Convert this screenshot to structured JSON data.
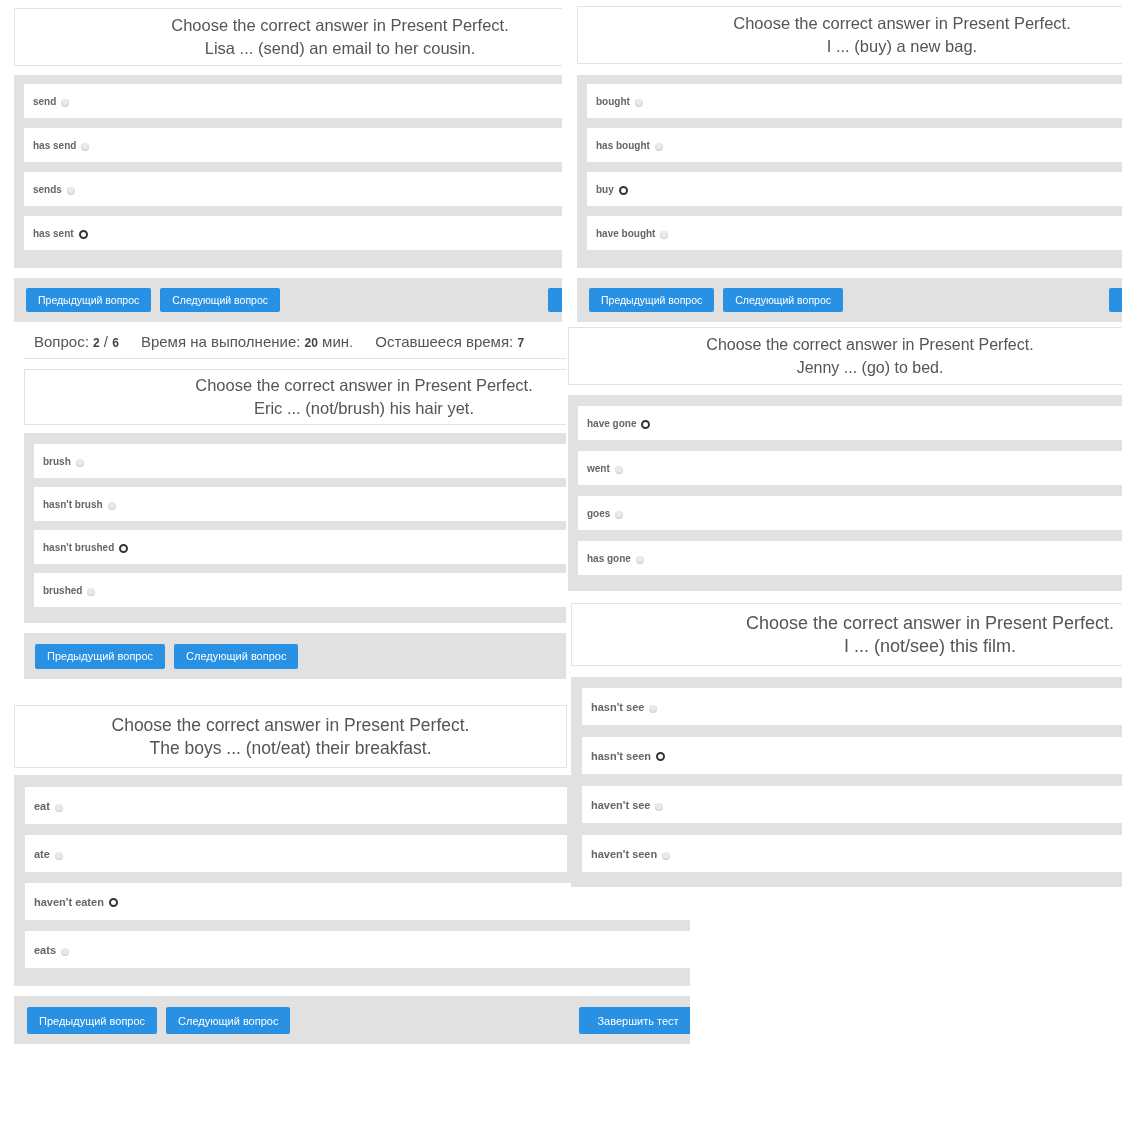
{
  "panels": [
    {
      "question": {
        "instruction": "Choose the correct answer in Present Perfect.",
        "sentence": "Lisa ... (send) an email to her cousin."
      },
      "options": [
        {
          "label": "send",
          "selected": false
        },
        {
          "label": "has send",
          "selected": false
        },
        {
          "label": "sends",
          "selected": false
        },
        {
          "label": "has sent",
          "selected": true
        }
      ],
      "nav_buttons": [
        "Предыдущий вопрос",
        "Следующий вопрос"
      ],
      "clipped_button": true
    },
    {
      "question": {
        "instruction": "Choose the correct answer in Present Perfect.",
        "sentence": "I ... (buy) a new bag."
      },
      "options": [
        {
          "label": "bought",
          "selected": false
        },
        {
          "label": "has bought",
          "selected": false
        },
        {
          "label": "buy",
          "selected": true
        },
        {
          "label": "have bought",
          "selected": false
        }
      ],
      "nav_buttons": [
        "Предыдущий вопрос",
        "Следующий вопрос"
      ],
      "clipped_button": true
    },
    {
      "status_bar": [
        "Вопрос: **2** / **6**",
        "Время на выполнение: **20** мин.",
        "Оставшееся время: **7**"
      ],
      "question": {
        "instruction": "Choose the correct answer in Present Perfect.",
        "sentence": "Eric ... (not/brush) his hair yet."
      },
      "options": [
        {
          "label": "brush",
          "selected": false
        },
        {
          "label": "hasn't brush",
          "selected": false
        },
        {
          "label": "hasn't brushed",
          "selected": true
        },
        {
          "label": "brushed",
          "selected": false
        }
      ],
      "nav_buttons": [
        "Предыдущий вопрос",
        "Следующий вопрос"
      ]
    },
    {
      "question": {
        "instruction": "Choose the correct answer in Present Perfect.",
        "sentence": "Jenny ... (go) to bed."
      },
      "options": [
        {
          "label": "have gone",
          "selected": true
        },
        {
          "label": "went",
          "selected": false
        },
        {
          "label": "goes",
          "selected": false
        },
        {
          "label": "has gone",
          "selected": false
        }
      ]
    },
    {
      "question": {
        "instruction": "Choose the correct answer in Present Perfect.",
        "sentence": "I ... (not/see) this film."
      },
      "options": [
        {
          "label": "hasn't see",
          "selected": false
        },
        {
          "label": "hasn't seen",
          "selected": true
        },
        {
          "label": "haven't see",
          "selected": false
        },
        {
          "label": "haven't seen",
          "selected": false
        }
      ]
    },
    {
      "question": {
        "instruction": "Choose the correct answer in Present Perfect.",
        "sentence": "The boys ... (not/eat) their breakfast."
      },
      "options": [
        {
          "label": "eat",
          "selected": false
        },
        {
          "label": "ate",
          "selected": false
        },
        {
          "label": "haven't eaten",
          "selected": true
        },
        {
          "label": "eats",
          "selected": false
        }
      ],
      "nav_buttons": [
        "Предыдущий вопрос",
        "Следующий вопрос"
      ],
      "finish_button": "Завершить тест"
    }
  ]
}
